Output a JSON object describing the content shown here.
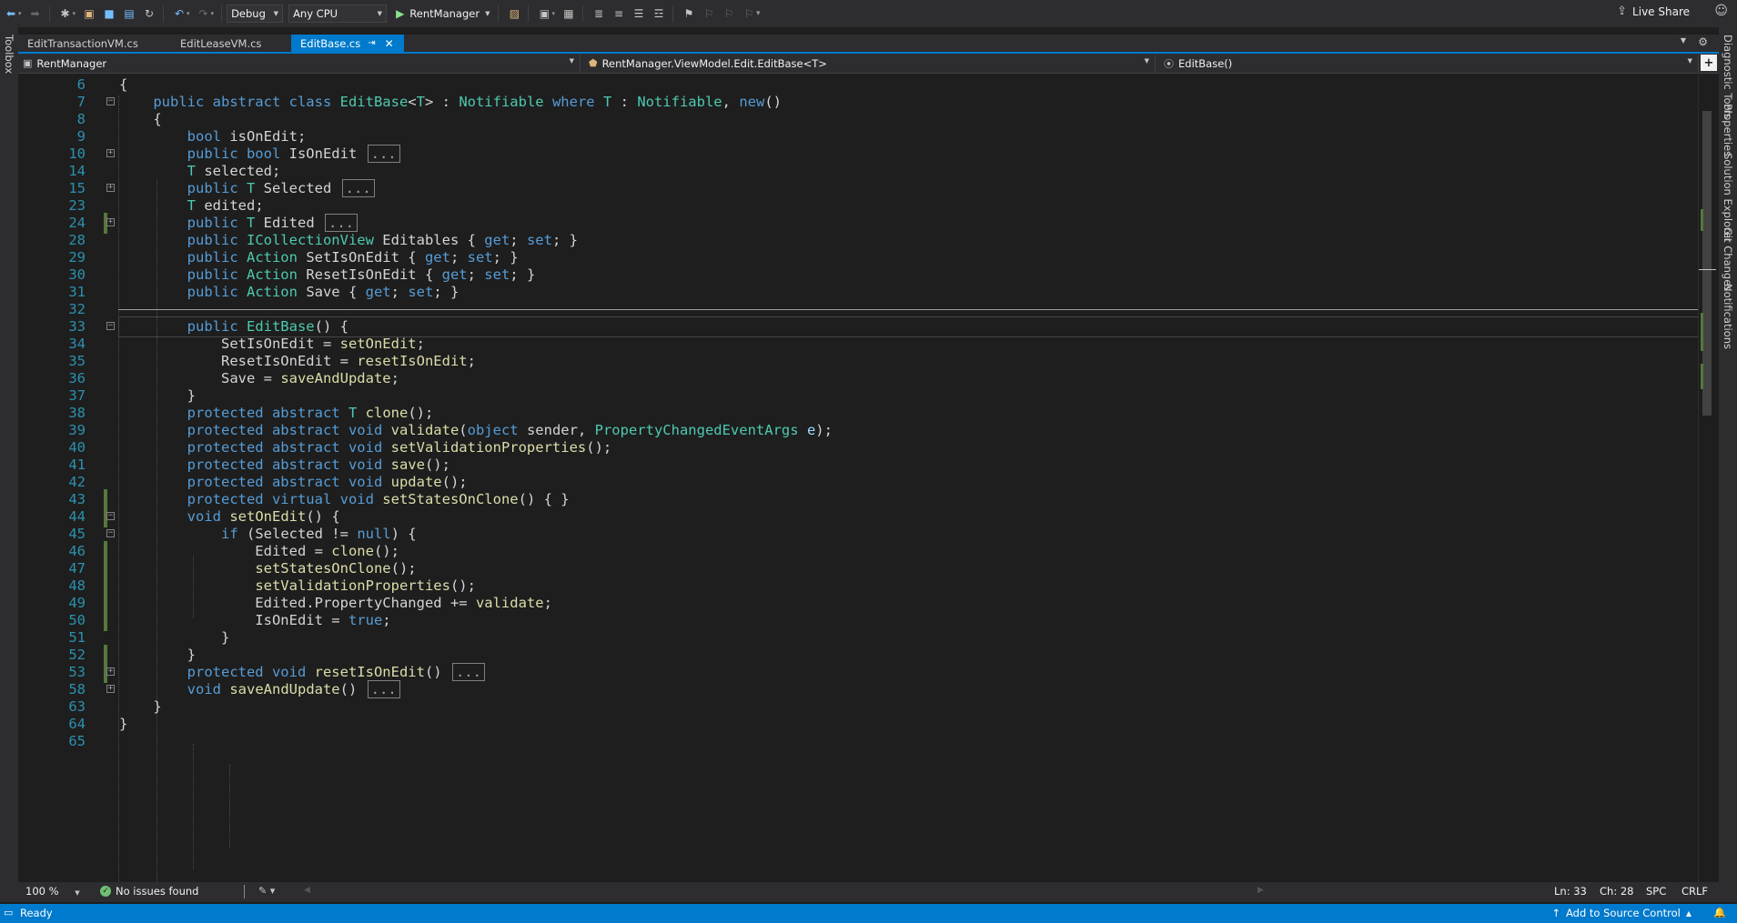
{
  "toolbar": {
    "configuration": "Debug",
    "platform": "Any CPU",
    "run_target": "RentManager",
    "live_share": "Live Share",
    "icons": [
      "back-icon",
      "forward-icon",
      "new-project-icon",
      "open-file-icon",
      "save-icon",
      "save-all-icon",
      "undo-icon",
      "redo-icon",
      "browser-link-icon",
      "toolbox-icon",
      "comment-icon",
      "bookmark-icon"
    ]
  },
  "side_tabs": {
    "left": "Toolbox",
    "right": [
      "Diagnostic Tools",
      "Properties",
      "Solution Explorer",
      "Git Changes",
      "Notifications"
    ]
  },
  "tabs": [
    {
      "label": "EditTransactionVM.cs",
      "active": false
    },
    {
      "label": "EditLeaseVM.cs",
      "active": false
    },
    {
      "label": "EditBase.cs",
      "active": true
    }
  ],
  "nav": {
    "project": "RentManager",
    "type": "RentManager.ViewModel.Edit.EditBase<T>",
    "member": "EditBase()"
  },
  "editor": {
    "current_line": "33",
    "lines": [
      {
        "n": "6",
        "fold": "",
        "chg": false,
        "t": [
          [
            "p",
            "{"
          ]
        ]
      },
      {
        "n": "7",
        "fold": "-",
        "chg": false,
        "t": [
          [
            "p",
            "    "
          ],
          [
            "kw",
            "public abstract class "
          ],
          [
            "cls",
            "EditBase"
          ],
          [
            "p",
            "<"
          ],
          [
            "ty",
            "T"
          ],
          [
            "p",
            "> : "
          ],
          [
            "cls",
            "Notifiable"
          ],
          [
            "kw",
            " where "
          ],
          [
            "ty",
            "T"
          ],
          [
            "p",
            " : "
          ],
          [
            "cls",
            "Notifiable"
          ],
          [
            "p",
            ", "
          ],
          [
            "kw",
            "new"
          ],
          [
            "p",
            "()"
          ]
        ]
      },
      {
        "n": "8",
        "fold": "",
        "chg": false,
        "t": [
          [
            "p",
            "    {"
          ]
        ]
      },
      {
        "n": "9",
        "fold": "",
        "chg": false,
        "t": [
          [
            "p",
            "        "
          ],
          [
            "kw",
            "bool"
          ],
          [
            "p",
            " isOnEdit;"
          ]
        ]
      },
      {
        "n": "10",
        "fold": "+",
        "chg": false,
        "t": [
          [
            "p",
            "        "
          ],
          [
            "kw",
            "public bool"
          ],
          [
            "p",
            " IsOnEdit "
          ],
          [
            "col",
            "..."
          ]
        ]
      },
      {
        "n": "14",
        "fold": "",
        "chg": false,
        "t": [
          [
            "p",
            "        "
          ],
          [
            "ty",
            "T"
          ],
          [
            "p",
            " selected;"
          ]
        ]
      },
      {
        "n": "15",
        "fold": "+",
        "chg": false,
        "t": [
          [
            "p",
            "        "
          ],
          [
            "kw",
            "public "
          ],
          [
            "ty",
            "T"
          ],
          [
            "p",
            " Selected "
          ],
          [
            "col",
            "..."
          ]
        ]
      },
      {
        "n": "23",
        "fold": "",
        "chg": false,
        "t": [
          [
            "p",
            "        "
          ],
          [
            "ty",
            "T"
          ],
          [
            "p",
            " edited;"
          ]
        ]
      },
      {
        "n": "24",
        "fold": "+",
        "chg": true,
        "t": [
          [
            "p",
            "        "
          ],
          [
            "kw",
            "public "
          ],
          [
            "ty",
            "T"
          ],
          [
            "p",
            " Edited "
          ],
          [
            "col",
            "..."
          ]
        ]
      },
      {
        "n": "28",
        "fold": "",
        "chg": false,
        "t": [
          [
            "p",
            "        "
          ],
          [
            "kw",
            "public "
          ],
          [
            "cls",
            "ICollectionView"
          ],
          [
            "p",
            " Editables { "
          ],
          [
            "kw",
            "get"
          ],
          [
            "p",
            "; "
          ],
          [
            "kw",
            "set"
          ],
          [
            "p",
            "; }"
          ]
        ]
      },
      {
        "n": "29",
        "fold": "",
        "chg": false,
        "t": [
          [
            "p",
            "        "
          ],
          [
            "kw",
            "public "
          ],
          [
            "cls",
            "Action"
          ],
          [
            "p",
            " SetIsOnEdit { "
          ],
          [
            "kw",
            "get"
          ],
          [
            "p",
            "; "
          ],
          [
            "kw",
            "set"
          ],
          [
            "p",
            "; }"
          ]
        ]
      },
      {
        "n": "30",
        "fold": "",
        "chg": false,
        "t": [
          [
            "p",
            "        "
          ],
          [
            "kw",
            "public "
          ],
          [
            "cls",
            "Action"
          ],
          [
            "p",
            " ResetIsOnEdit { "
          ],
          [
            "kw",
            "get"
          ],
          [
            "p",
            "; "
          ],
          [
            "kw",
            "set"
          ],
          [
            "p",
            "; }"
          ]
        ]
      },
      {
        "n": "31",
        "fold": "",
        "chg": false,
        "t": [
          [
            "p",
            "        "
          ],
          [
            "kw",
            "public "
          ],
          [
            "cls",
            "Action"
          ],
          [
            "p",
            " Save { "
          ],
          [
            "kw",
            "get"
          ],
          [
            "p",
            "; "
          ],
          [
            "kw",
            "set"
          ],
          [
            "p",
            "; }"
          ]
        ]
      },
      {
        "n": "32",
        "fold": "",
        "chg": false,
        "t": []
      },
      {
        "n": "33",
        "fold": "-",
        "chg": false,
        "t": [
          [
            "p",
            "        "
          ],
          [
            "kw",
            "public "
          ],
          [
            "cls",
            "EditBase"
          ],
          [
            "p",
            "() {"
          ]
        ]
      },
      {
        "n": "34",
        "fold": "",
        "chg": false,
        "t": [
          [
            "p",
            "            SetIsOnEdit = "
          ],
          [
            "me",
            "setOnEdit"
          ],
          [
            "p",
            ";"
          ]
        ]
      },
      {
        "n": "35",
        "fold": "",
        "chg": false,
        "t": [
          [
            "p",
            "            ResetIsOnEdit = "
          ],
          [
            "me",
            "resetIsOnEdit"
          ],
          [
            "p",
            ";"
          ]
        ]
      },
      {
        "n": "36",
        "fold": "",
        "chg": false,
        "t": [
          [
            "p",
            "            Save = "
          ],
          [
            "me",
            "saveAndUpdate"
          ],
          [
            "p",
            ";"
          ]
        ]
      },
      {
        "n": "37",
        "fold": "",
        "chg": false,
        "t": [
          [
            "p",
            "        }"
          ]
        ]
      },
      {
        "n": "38",
        "fold": "",
        "chg": false,
        "t": [
          [
            "p",
            "        "
          ],
          [
            "kw",
            "protected abstract "
          ],
          [
            "ty",
            "T"
          ],
          [
            "p",
            " "
          ],
          [
            "me",
            "clone"
          ],
          [
            "p",
            "();"
          ]
        ]
      },
      {
        "n": "39",
        "fold": "",
        "chg": false,
        "t": [
          [
            "p",
            "        "
          ],
          [
            "kw",
            "protected abstract void "
          ],
          [
            "me",
            "validate"
          ],
          [
            "p",
            "("
          ],
          [
            "kw",
            "object"
          ],
          [
            "p",
            " sender, "
          ],
          [
            "cls",
            "PropertyChangedEventArgs"
          ],
          [
            "p",
            " "
          ],
          [
            "par",
            "e"
          ],
          [
            "p",
            ");"
          ]
        ]
      },
      {
        "n": "40",
        "fold": "",
        "chg": false,
        "t": [
          [
            "p",
            "        "
          ],
          [
            "kw",
            "protected abstract void "
          ],
          [
            "me",
            "setValidationProperties"
          ],
          [
            "p",
            "();"
          ]
        ]
      },
      {
        "n": "41",
        "fold": "",
        "chg": false,
        "t": [
          [
            "p",
            "        "
          ],
          [
            "kw",
            "protected abstract void "
          ],
          [
            "me",
            "save"
          ],
          [
            "p",
            "();"
          ]
        ]
      },
      {
        "n": "42",
        "fold": "",
        "chg": false,
        "t": [
          [
            "p",
            "        "
          ],
          [
            "kw",
            "protected abstract void "
          ],
          [
            "me",
            "update"
          ],
          [
            "p",
            "();"
          ]
        ]
      },
      {
        "n": "43",
        "fold": "",
        "chg": true,
        "t": [
          [
            "p",
            "        "
          ],
          [
            "kw",
            "protected virtual void "
          ],
          [
            "me",
            "setStatesOnClone"
          ],
          [
            "p",
            "() { }"
          ]
        ]
      },
      {
        "n": "44",
        "fold": "-",
        "chg": true,
        "t": [
          [
            "p",
            "        "
          ],
          [
            "kw",
            "void "
          ],
          [
            "me",
            "setOnEdit"
          ],
          [
            "p",
            "() {"
          ]
        ]
      },
      {
        "n": "45",
        "fold": "-",
        "chg": false,
        "t": [
          [
            "p",
            "            "
          ],
          [
            "kw",
            "if"
          ],
          [
            "p",
            " (Selected != "
          ],
          [
            "kw",
            "null"
          ],
          [
            "p",
            ") {"
          ]
        ]
      },
      {
        "n": "46",
        "fold": "",
        "chg": true,
        "t": [
          [
            "p",
            "                Edited = "
          ],
          [
            "me",
            "clone"
          ],
          [
            "p",
            "();"
          ]
        ]
      },
      {
        "n": "47",
        "fold": "",
        "chg": true,
        "t": [
          [
            "p",
            "                "
          ],
          [
            "me",
            "setStatesOnClone"
          ],
          [
            "p",
            "();"
          ]
        ]
      },
      {
        "n": "48",
        "fold": "",
        "chg": true,
        "t": [
          [
            "p",
            "                "
          ],
          [
            "me",
            "setValidationProperties"
          ],
          [
            "p",
            "();"
          ]
        ]
      },
      {
        "n": "49",
        "fold": "",
        "chg": true,
        "t": [
          [
            "p",
            "                Edited.PropertyChanged += "
          ],
          [
            "me",
            "validate"
          ],
          [
            "p",
            ";"
          ]
        ]
      },
      {
        "n": "50",
        "fold": "",
        "chg": true,
        "t": [
          [
            "p",
            "                IsOnEdit = "
          ],
          [
            "kw",
            "true"
          ],
          [
            "p",
            ";"
          ]
        ]
      },
      {
        "n": "51",
        "fold": "",
        "chg": false,
        "t": [
          [
            "p",
            "            }"
          ]
        ]
      },
      {
        "n": "52",
        "fold": "",
        "chg": true,
        "t": [
          [
            "p",
            "        }"
          ]
        ]
      },
      {
        "n": "53",
        "fold": "+",
        "chg": true,
        "t": [
          [
            "p",
            "        "
          ],
          [
            "kw",
            "protected void "
          ],
          [
            "me",
            "resetIsOnEdit"
          ],
          [
            "p",
            "() "
          ],
          [
            "col",
            "..."
          ]
        ]
      },
      {
        "n": "58",
        "fold": "+",
        "chg": false,
        "t": [
          [
            "p",
            "        "
          ],
          [
            "kw",
            "void "
          ],
          [
            "me",
            "saveAndUpdate"
          ],
          [
            "p",
            "() "
          ],
          [
            "col",
            "..."
          ]
        ]
      },
      {
        "n": "63",
        "fold": "",
        "chg": false,
        "t": [
          [
            "p",
            "    }"
          ]
        ]
      },
      {
        "n": "64",
        "fold": "",
        "chg": false,
        "t": [
          [
            "p",
            "}"
          ]
        ]
      },
      {
        "n": "65",
        "fold": "",
        "chg": false,
        "t": []
      }
    ]
  },
  "infobar": {
    "zoom": "100 %",
    "issues": "No issues found",
    "line": "Ln: 33",
    "char": "Ch: 28",
    "spacing": "SPC",
    "line_ending": "CRLF"
  },
  "status": {
    "ready": "Ready",
    "source_control": "Add to Source Control"
  },
  "colors": {
    "keyword": "#569cd6",
    "type": "#4ec9b0",
    "method": "#dcdcaa",
    "line_number": "#2b91af",
    "accent": "#007acc"
  }
}
